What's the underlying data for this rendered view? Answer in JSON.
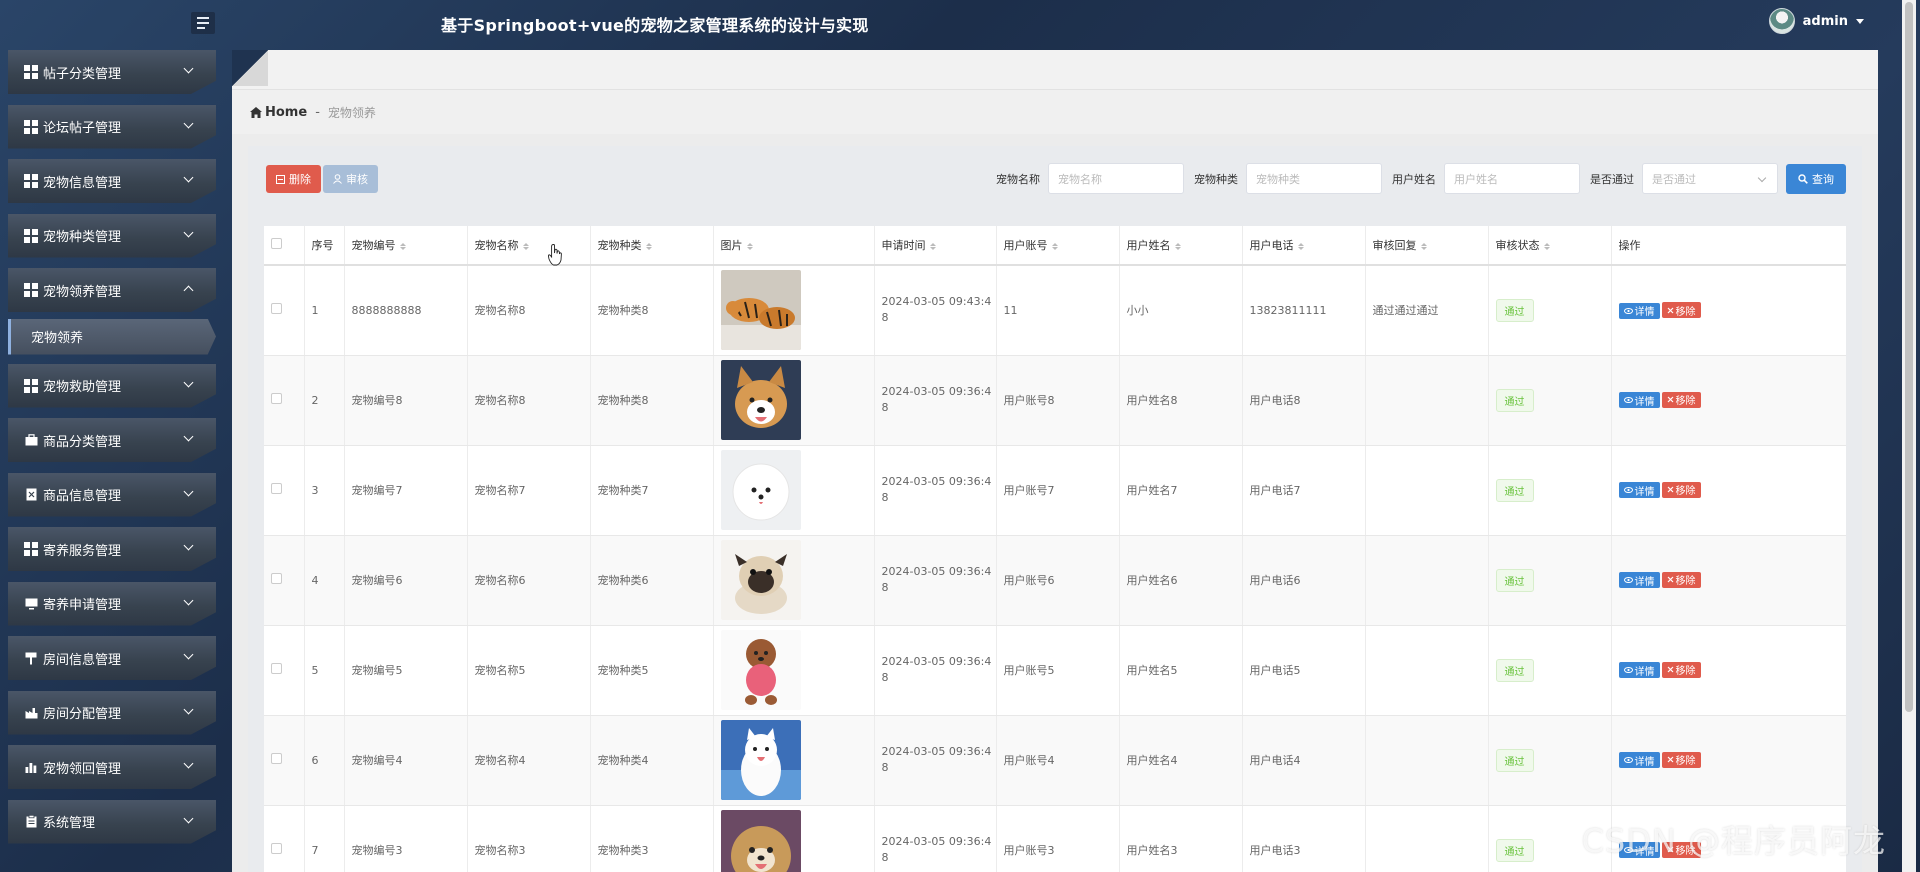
{
  "header": {
    "title": "基于Springboot+vue的宠物之家管理系统的设计与实现",
    "username": "admin"
  },
  "sidebar": {
    "items": [
      {
        "label": "帖子分类管理",
        "icon": "grid-icon"
      },
      {
        "label": "论坛帖子管理",
        "icon": "grid-icon"
      },
      {
        "label": "宠物信息管理",
        "icon": "grid-icon"
      },
      {
        "label": "宠物种类管理",
        "icon": "grid-icon"
      },
      {
        "label": "宠物领养管理",
        "icon": "grid-icon",
        "expanded": true
      },
      {
        "label": "宠物救助管理",
        "icon": "grid-icon"
      },
      {
        "label": "商品分类管理",
        "icon": "briefcase-icon"
      },
      {
        "label": "商品信息管理",
        "icon": "document-x-icon"
      },
      {
        "label": "寄养服务管理",
        "icon": "grid-icon"
      },
      {
        "label": "寄养申请管理",
        "icon": "monitor-icon"
      },
      {
        "label": "房间信息管理",
        "icon": "flag-icon"
      },
      {
        "label": "房间分配管理",
        "icon": "factory-icon"
      },
      {
        "label": "宠物领回管理",
        "icon": "bar-chart-icon"
      },
      {
        "label": "系统管理",
        "icon": "clipboard-icon"
      }
    ],
    "sub_item": "宠物领养"
  },
  "breadcrumb": {
    "home": "Home",
    "separator": "-",
    "current": "宠物领养"
  },
  "toolbar": {
    "delete_label": "删除",
    "audit_label": "审核",
    "query_label": "查询"
  },
  "search": {
    "pet_name_label": "宠物名称",
    "pet_name_placeholder": "宠物名称",
    "pet_type_label": "宠物种类",
    "pet_type_placeholder": "宠物种类",
    "user_name_label": "用户姓名",
    "user_name_placeholder": "用户姓名",
    "passed_label": "是否通过",
    "passed_placeholder": "是否通过"
  },
  "table": {
    "columns": [
      "序号",
      "宠物编号",
      "宠物名称",
      "宠物种类",
      "图片",
      "申请时间",
      "用户账号",
      "用户姓名",
      "用户电话",
      "审核回复",
      "审核状态",
      "操作"
    ],
    "rows": [
      {
        "idx": "1",
        "code": "8888888888",
        "name": "宠物名称8",
        "type": "宠物种类8",
        "pic": "tiger",
        "time1": "2024-03-05 09:43:4",
        "time2": "8",
        "account": "11",
        "uname": "小小",
        "phone": "13823811111",
        "reply": "通过通过通过",
        "status": "通过"
      },
      {
        "idx": "2",
        "code": "宠物编号8",
        "name": "宠物名称8",
        "type": "宠物种类8",
        "pic": "corgi",
        "time1": "2024-03-05 09:36:4",
        "time2": "8",
        "account": "用户账号8",
        "uname": "用户姓名8",
        "phone": "用户电话8",
        "reply": "",
        "status": "通过"
      },
      {
        "idx": "3",
        "code": "宠物编号7",
        "name": "宠物名称7",
        "type": "宠物种类7",
        "pic": "pomeranian",
        "time1": "2024-03-05 09:36:4",
        "time2": "8",
        "account": "用户账号7",
        "uname": "用户姓名7",
        "phone": "用户电话7",
        "reply": "",
        "status": "通过"
      },
      {
        "idx": "4",
        "code": "宠物编号6",
        "name": "宠物名称6",
        "type": "宠物种类6",
        "pic": "pug",
        "time1": "2024-03-05 09:36:4",
        "time2": "8",
        "account": "用户账号6",
        "uname": "用户姓名6",
        "phone": "用户电话6",
        "reply": "",
        "status": "通过"
      },
      {
        "idx": "5",
        "code": "宠物编号5",
        "name": "宠物名称5",
        "type": "宠物种类5",
        "pic": "poodle",
        "time1": "2024-03-05 09:36:4",
        "time2": "8",
        "account": "用户账号5",
        "uname": "用户姓名5",
        "phone": "用户电话5",
        "reply": "",
        "status": "通过"
      },
      {
        "idx": "6",
        "code": "宠物编号4",
        "name": "宠物名称4",
        "type": "宠物种类4",
        "pic": "samoyed",
        "time1": "2024-03-05 09:36:4",
        "time2": "8",
        "account": "用户账号4",
        "uname": "用户姓名4",
        "phone": "用户电话4",
        "reply": "",
        "status": "通过"
      },
      {
        "idx": "7",
        "code": "宠物编号3",
        "name": "宠物名称3",
        "type": "宠物种类3",
        "pic": "shihtzu",
        "time1": "2024-03-05 09:36:4",
        "time2": "8",
        "account": "用户账号3",
        "uname": "用户姓名3",
        "phone": "用户电话3",
        "reply": "",
        "status": "通过"
      }
    ],
    "view_label": "详情",
    "remove_label": "移除"
  },
  "watermark": "CSDN @程序员阿龙",
  "colors": {
    "primary": "#3a86d6",
    "danger": "#e05b4c",
    "success": "#67c23a",
    "header_bg": "#1f3350"
  }
}
